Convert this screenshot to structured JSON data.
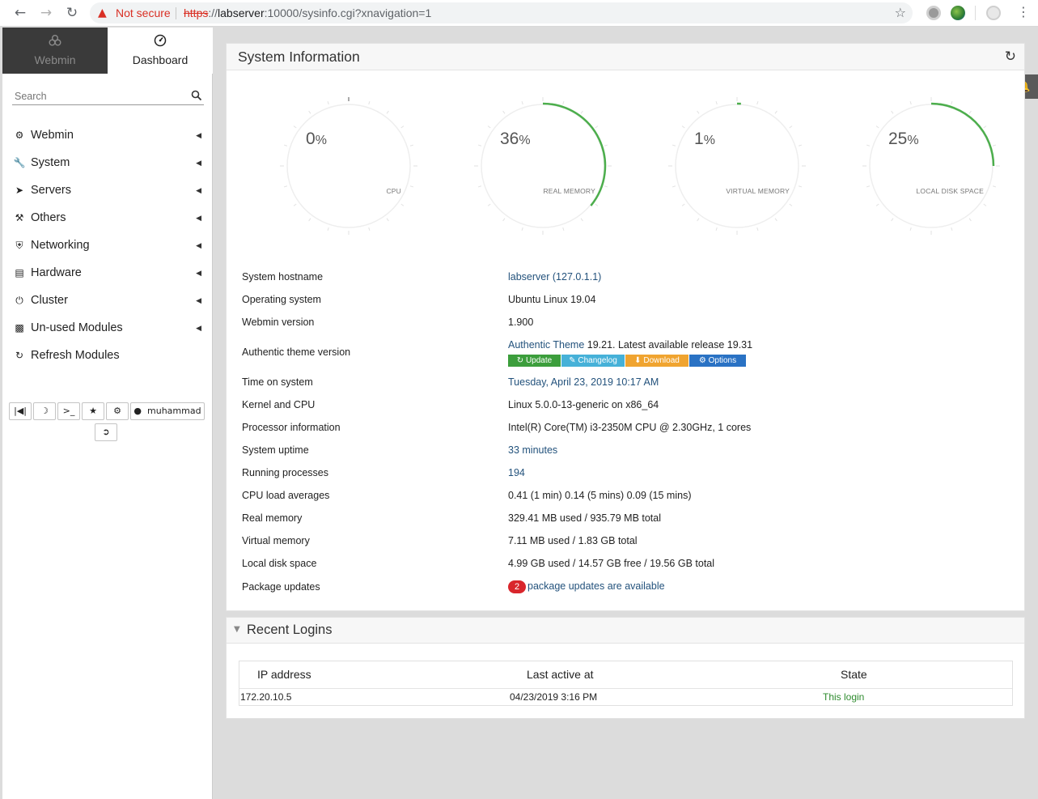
{
  "browser": {
    "not_secure": "Not secure",
    "url_scheme": "https",
    "url_sep": "://",
    "url_host": "labserver",
    "url_rest": ":10000/sysinfo.cgi?xnavigation=1"
  },
  "sidebar": {
    "tabs": [
      {
        "label": "Webmin",
        "icon": "webmin-logo-icon"
      },
      {
        "label": "Dashboard",
        "icon": "dashboard-icon"
      }
    ],
    "search_placeholder": "Search",
    "menu": [
      {
        "label": "Webmin",
        "icon": "gear-icon"
      },
      {
        "label": "System",
        "icon": "wrench-icon"
      },
      {
        "label": "Servers",
        "icon": "rocket-icon"
      },
      {
        "label": "Others",
        "icon": "gavel-icon"
      },
      {
        "label": "Networking",
        "icon": "shield-icon"
      },
      {
        "label": "Hardware",
        "icon": "hdd-icon"
      },
      {
        "label": "Cluster",
        "icon": "power-icon"
      },
      {
        "label": "Un-used Modules",
        "icon": "puzzle-icon"
      },
      {
        "label": "Refresh Modules",
        "icon": "refresh-icon"
      }
    ],
    "user": "muhammad"
  },
  "system_info": {
    "title": "System Information",
    "gauges": [
      {
        "label": "CPU",
        "value": 0,
        "display": "0"
      },
      {
        "label": "REAL MEMORY",
        "value": 36,
        "display": "36"
      },
      {
        "label": "VIRTUAL MEMORY",
        "value": 1,
        "display": "1"
      },
      {
        "label": "LOCAL DISK SPACE",
        "value": 25,
        "display": "25"
      }
    ],
    "percent_sign": "%",
    "gauge_color": "#4cae4c",
    "rows": {
      "hostname": {
        "label": "System hostname",
        "value": "labserver (127.0.1.1)"
      },
      "os": {
        "label": "Operating system",
        "value": "Ubuntu Linux 19.04"
      },
      "webmin": {
        "label": "Webmin version",
        "value": "1.900"
      },
      "theme": {
        "label": "Authentic theme version",
        "link": "Authentic Theme",
        "value": " 19.21. Latest available release 19.31"
      },
      "time": {
        "label": "Time on system",
        "value": "Tuesday, April 23, 2019 10:17 AM"
      },
      "kernel": {
        "label": "Kernel and CPU",
        "value": "Linux 5.0.0-13-generic on x86_64"
      },
      "processor": {
        "label": "Processor information",
        "value": "Intel(R) Core(TM) i3-2350M CPU @ 2.30GHz, 1 cores"
      },
      "uptime": {
        "label": "System uptime",
        "value": "33 minutes"
      },
      "processes": {
        "label": "Running processes",
        "value": "194"
      },
      "load": {
        "label": "CPU load averages",
        "value": "0.41 (1 min) 0.14 (5 mins) 0.09 (15 mins)"
      },
      "real_mem": {
        "label": "Real memory",
        "value": "329.41 MB used / 935.79 MB total"
      },
      "virt_mem": {
        "label": "Virtual memory",
        "value": "7.11 MB used / 1.83 GB total"
      },
      "disk": {
        "label": "Local disk space",
        "value": "4.99 GB used / 14.57 GB free / 19.56 GB total"
      },
      "updates": {
        "label": "Package updates",
        "count": "2",
        "value": "package updates are available"
      }
    },
    "theme_buttons": [
      {
        "label": "Update",
        "icon": "refresh-icon",
        "color": "#3c9e3c"
      },
      {
        "label": "Changelog",
        "icon": "edit-icon",
        "color": "#46b1d8"
      },
      {
        "label": "Download",
        "icon": "download-icon",
        "color": "#f0a430"
      },
      {
        "label": "Options",
        "icon": "cogs-icon",
        "color": "#2a72c4"
      }
    ]
  },
  "recent_logins": {
    "title": "Recent Logins",
    "columns": [
      "IP address",
      "Last active at",
      "State"
    ],
    "rows": [
      {
        "ip": "172.20.10.5",
        "time": "04/23/2019 3:16 PM",
        "state": "This login"
      }
    ]
  }
}
